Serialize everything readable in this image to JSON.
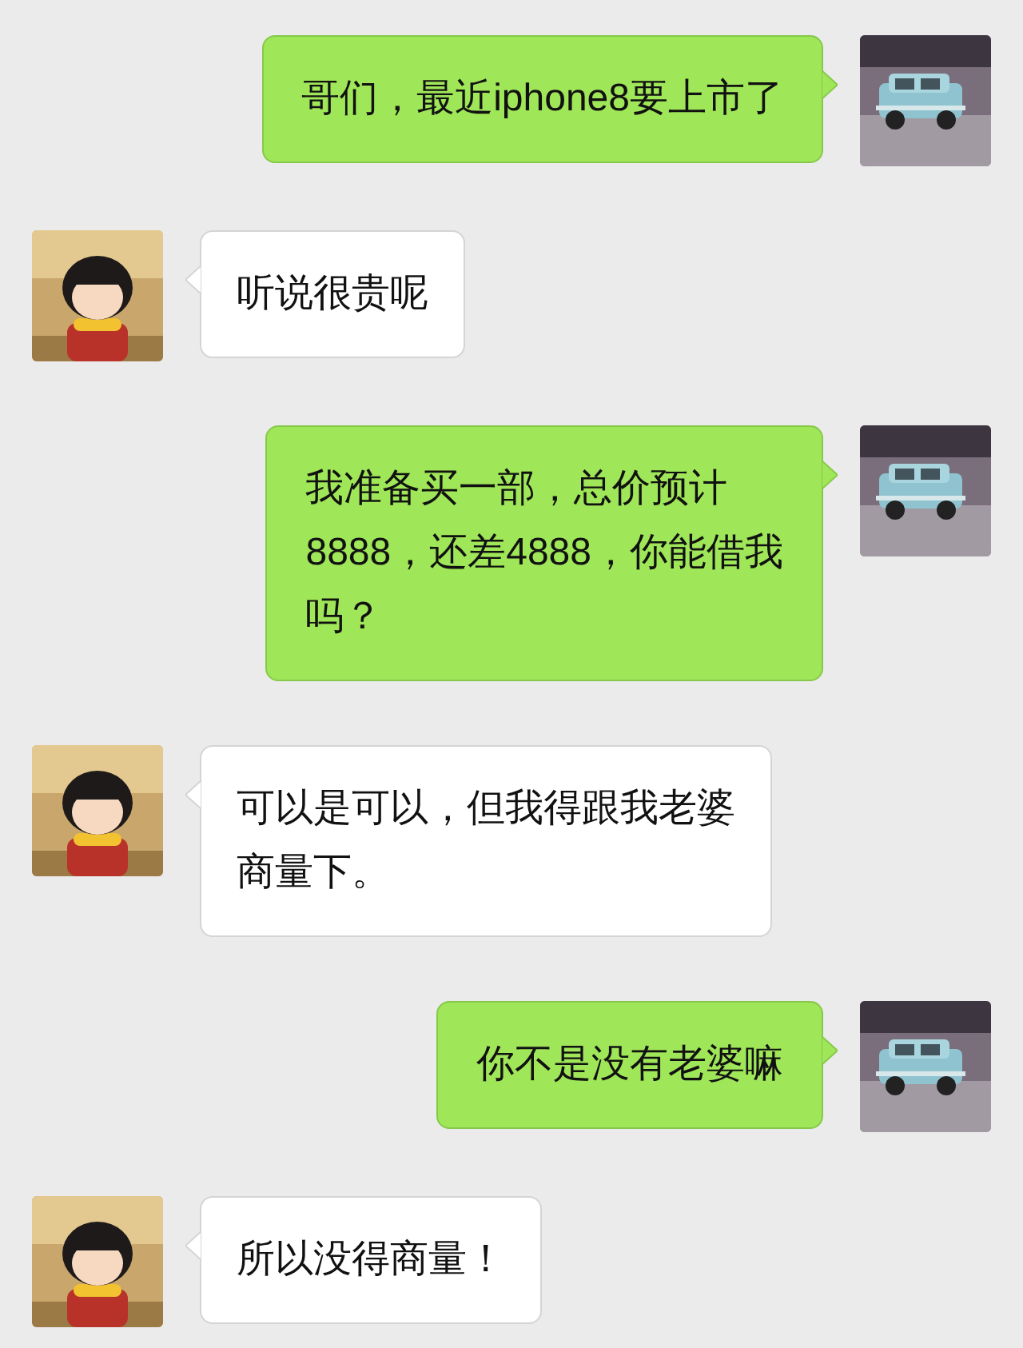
{
  "messages": [
    {
      "outgoing": true,
      "lines": [
        "哥们，最近iphone8要上市了"
      ],
      "avatar": {
        "kind": "picture"
      }
    },
    {
      "outgoing": false,
      "lines": [
        "听说很贵呢"
      ],
      "avatar": {
        "kind": "picture"
      }
    },
    {
      "outgoing": true,
      "lines": [
        "我准备买一部，总价预计",
        "8888，还差4888，你能借我",
        "吗？"
      ],
      "avatar": {
        "kind": "picture"
      }
    },
    {
      "outgoing": false,
      "lines": [
        "可以是可以，但我得跟我老婆",
        "商量下。"
      ],
      "avatar": {
        "kind": "picture"
      }
    },
    {
      "outgoing": true,
      "lines": [
        "你不是没有老婆嘛"
      ],
      "avatar": {
        "kind": "picture"
      }
    },
    {
      "outgoing": false,
      "lines": [
        "所以没得商量！"
      ],
      "avatar": {
        "kind": "picture"
      }
    }
  ]
}
